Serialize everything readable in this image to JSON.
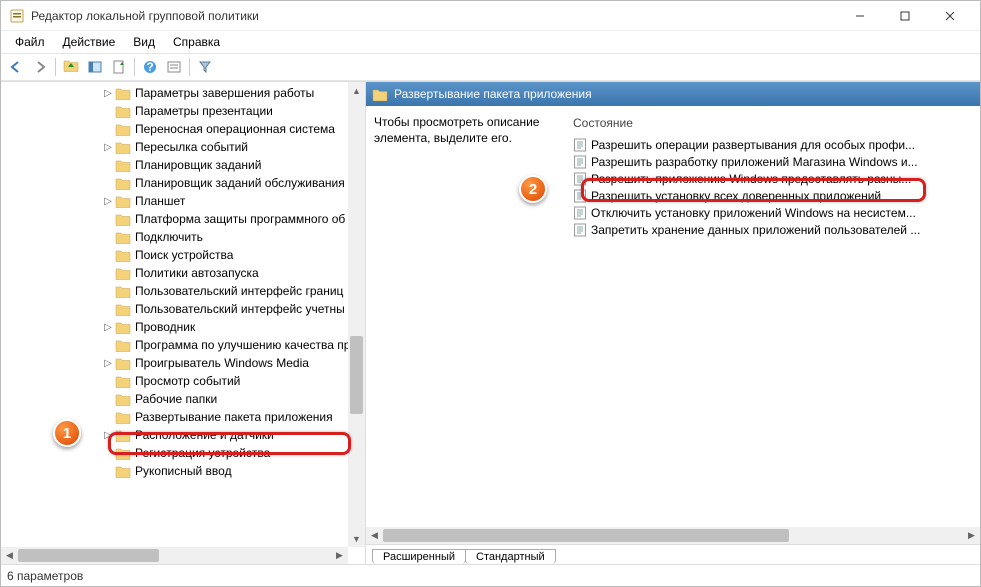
{
  "window": {
    "title": "Редактор локальной групповой политики"
  },
  "menu": {
    "file": "Файл",
    "action": "Действие",
    "view": "Вид",
    "help": "Справка"
  },
  "tree": {
    "items": [
      {
        "label": "Параметры завершения работы",
        "exp": "▷"
      },
      {
        "label": "Параметры презентации",
        "exp": ""
      },
      {
        "label": "Переносная операционная система",
        "exp": ""
      },
      {
        "label": "Пересылка событий",
        "exp": "▷"
      },
      {
        "label": "Планировщик заданий",
        "exp": ""
      },
      {
        "label": "Планировщик заданий обслуживания",
        "exp": ""
      },
      {
        "label": "Планшет",
        "exp": "▷"
      },
      {
        "label": "Платформа защиты программного об",
        "exp": ""
      },
      {
        "label": "Подключить",
        "exp": ""
      },
      {
        "label": "Поиск устройства",
        "exp": ""
      },
      {
        "label": "Политики автозапуска",
        "exp": ""
      },
      {
        "label": "Пользовательский интерфейс границ",
        "exp": ""
      },
      {
        "label": "Пользовательский интерфейс учетны",
        "exp": ""
      },
      {
        "label": "Проводник",
        "exp": "▷"
      },
      {
        "label": "Программа по улучшению качества пр",
        "exp": ""
      },
      {
        "label": "Проигрыватель Windows Media",
        "exp": "▷"
      },
      {
        "label": "Просмотр событий",
        "exp": ""
      },
      {
        "label": "Рабочие папки",
        "exp": ""
      },
      {
        "label": "Развертывание пакета приложения",
        "exp": ""
      },
      {
        "label": "Расположение и датчики",
        "exp": "▷"
      },
      {
        "label": "Регистрация устройства",
        "exp": ""
      },
      {
        "label": "Рукописный ввод",
        "exp": ""
      }
    ]
  },
  "details": {
    "header_title": "Развертывание пакета приложения",
    "description": "Чтобы просмотреть описание элемента, выделите его.",
    "col_state": "Состояние",
    "policies": [
      "Разрешить операции развертывания для особых профи...",
      "Разрешить разработку приложений Магазина Windows и...",
      "Разрешить приложению Windows предоставлять разны...",
      "Разрешить установку всех доверенных приложений",
      "Отключить установку приложений Windows на несистем...",
      "Запретить хранение данных приложений пользователей ..."
    ]
  },
  "tabs": {
    "extended": "Расширенный",
    "standard": "Стандартный"
  },
  "statusbar": {
    "text": "6 параметров"
  },
  "icons": {
    "back": "back-icon",
    "forward": "forward-icon",
    "up": "up-icon",
    "show": "show-icon",
    "export": "export-icon",
    "help": "help-icon",
    "props": "props-icon",
    "filter": "filter-icon"
  }
}
